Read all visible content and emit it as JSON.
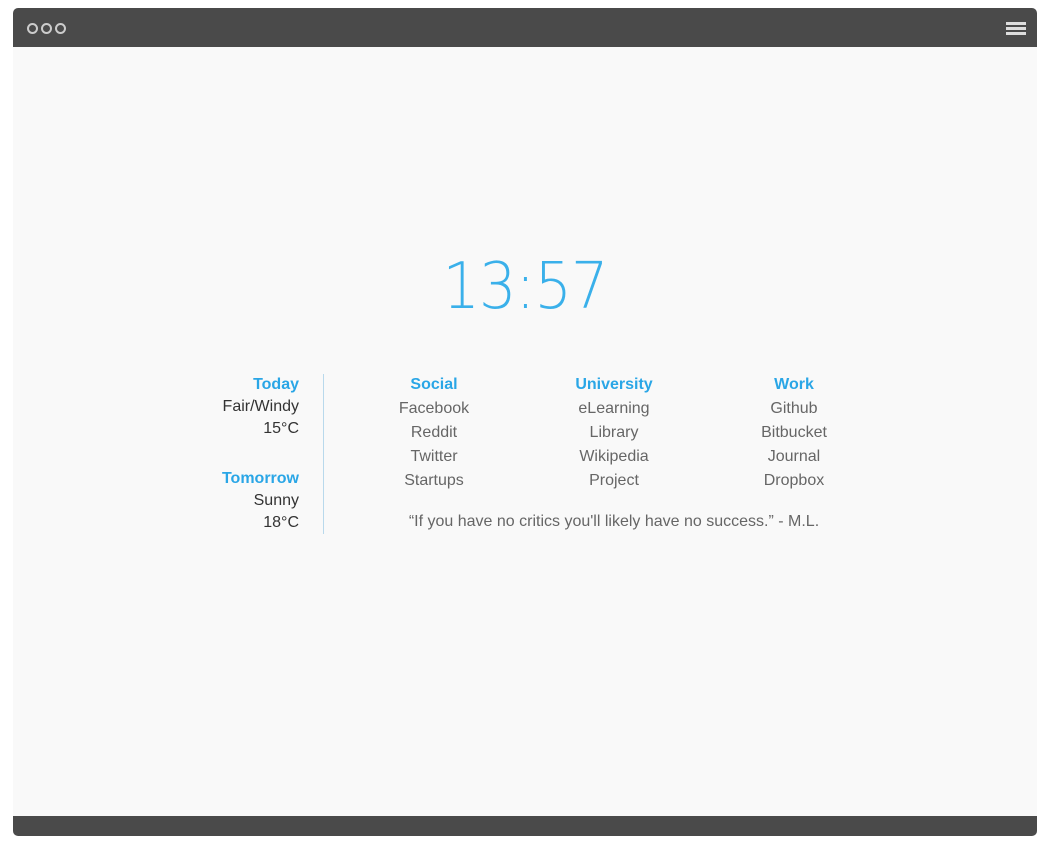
{
  "window": {
    "menu_icon": "hamburger-icon",
    "window_controls_icon": "three-circles-icon"
  },
  "clock": {
    "time": "13:57"
  },
  "weather": {
    "today": {
      "label": "Today",
      "condition": "Fair/Windy",
      "temp": "15°C"
    },
    "tomorrow": {
      "label": "Tomorrow",
      "condition": "Sunny",
      "temp": "18°C"
    }
  },
  "links": [
    {
      "title": "Social",
      "items": [
        "Facebook",
        "Reddit",
        "Twitter",
        "Startups"
      ]
    },
    {
      "title": "University",
      "items": [
        "eLearning",
        "Library",
        "Wikipedia",
        "Project"
      ]
    },
    {
      "title": "Work",
      "items": [
        "Github",
        "Bitbucket",
        "Journal",
        "Dropbox"
      ]
    }
  ],
  "quote": "“If you have no critics you'll likely have no success.” - M.L.",
  "colors": {
    "accent": "#2aa6e6",
    "bar": "#4a4a4a",
    "background": "#f9f9f9"
  }
}
